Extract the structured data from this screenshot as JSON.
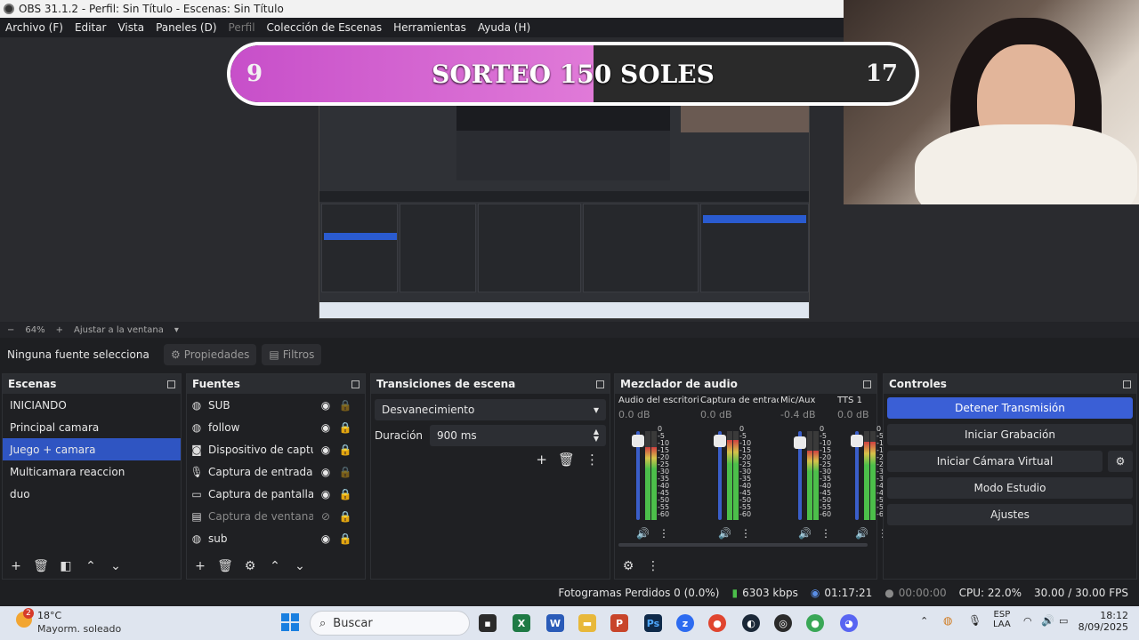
{
  "window": {
    "title": "OBS 31.1.2 - Perfil: Sin Título - Escenas: Sin Título"
  },
  "menu": [
    "Archivo (F)",
    "Editar",
    "Vista",
    "Paneles (D)",
    "Perfil",
    "Colección de Escenas",
    "Herramientas",
    "Ayuda (H)"
  ],
  "menu_disabled_index": 4,
  "overlay": {
    "left_number": "9",
    "title": "SORTEO 150 SOLES",
    "right_number": "17",
    "progress_fraction": 0.53
  },
  "zoom": {
    "minus": "−",
    "value": "64%",
    "plus": "+",
    "fit_label": "Ajustar a la ventana"
  },
  "source_toolbar": {
    "no_source": "Ninguna fuente selecciona",
    "properties": "Propiedades",
    "filters": "Filtros"
  },
  "scenes": {
    "title": "Escenas",
    "items": [
      "INICIANDO",
      "Principal camara",
      "Juego + camara",
      "Multicamara reaccion",
      "duo"
    ],
    "selected_index": 2
  },
  "sources": {
    "title": "Fuentes",
    "items": [
      {
        "name": "SUB",
        "icon": "globe-icon",
        "visible": true,
        "locked": false
      },
      {
        "name": "follow",
        "icon": "globe-icon",
        "visible": true,
        "locked": true
      },
      {
        "name": "Dispositivo de captura de video",
        "icon": "camera-icon",
        "visible": true,
        "locked": true
      },
      {
        "name": "Captura de entrada audio",
        "icon": "mic-icon",
        "visible": true,
        "locked": false
      },
      {
        "name": "Captura de pantalla",
        "icon": "monitor-icon",
        "visible": true,
        "locked": true
      },
      {
        "name": "Captura de ventana",
        "icon": "window-icon",
        "visible": false,
        "locked": true
      },
      {
        "name": "sub",
        "icon": "globe-icon",
        "visible": true,
        "locked": true
      }
    ]
  },
  "transitions": {
    "title": "Transiciones de escena",
    "selected": "Desvanecimiento",
    "duration_label": "Duración",
    "duration_value": "900 ms"
  },
  "mixer": {
    "title": "Mezclador de audio",
    "channels": [
      {
        "name": "Audio del escritorio",
        "db": "0.0 dB",
        "level": 0.82,
        "fader": 0.92
      },
      {
        "name": "Captura de entrada",
        "db": "0.0 dB",
        "level": 0.9,
        "fader": 0.92
      },
      {
        "name": "Mic/Aux",
        "db": "-0.4 dB",
        "level": 0.78,
        "fader": 0.9
      },
      {
        "name": "TTS 1",
        "db": "0.0 dB",
        "level": 0.88,
        "fader": 0.92
      }
    ],
    "scale": [
      "0",
      "-5",
      "-10",
      "-15",
      "-20",
      "-25",
      "-30",
      "-35",
      "-40",
      "-45",
      "-50",
      "-55",
      "-60"
    ]
  },
  "controls": {
    "title": "Controles",
    "buttons": [
      "Detener Transmisión",
      "Iniciar Grabación",
      "Iniciar Cámara Virtual",
      "Modo Estudio",
      "Ajustes"
    ]
  },
  "status": {
    "dropped": "Fotogramas Perdidos 0 (0.0%)",
    "bitrate": "6303 kbps",
    "stream_time": "01:17:21",
    "rec_time": "00:00:00",
    "cpu": "CPU: 22.0%",
    "fps": "30.00 / 30.00 FPS"
  },
  "taskbar": {
    "weather_badge": "2",
    "temp": "18°C",
    "weather": "Mayorm. soleado",
    "search": "Buscar",
    "lang1": "ESP",
    "lang2": "LAA",
    "time": "18:12",
    "date": "8/09/2025"
  },
  "colors": {
    "accent": "#3a5fd6",
    "selection": "#2f55c2",
    "overlay_pink": "#d66ad3"
  }
}
